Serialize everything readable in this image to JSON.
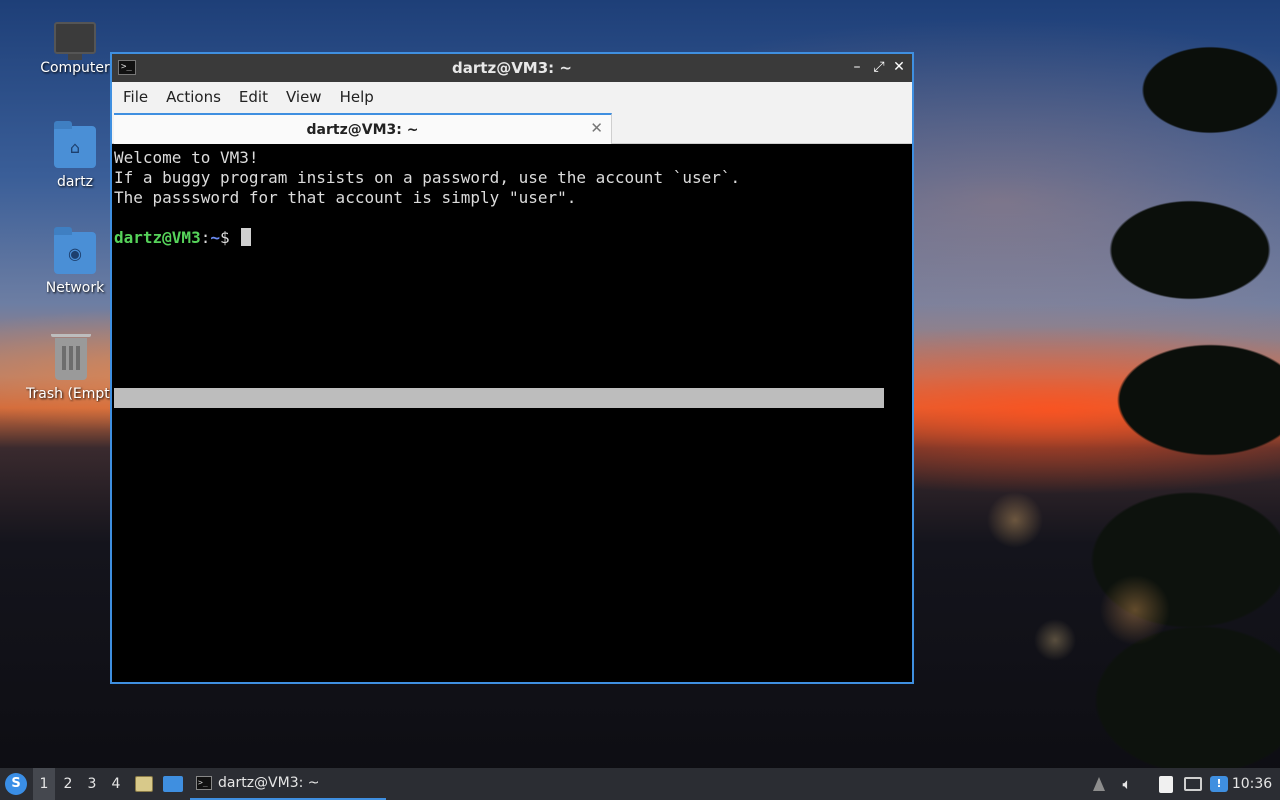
{
  "desktop": {
    "icons": [
      {
        "label": "Computer",
        "icon": "computer-icon"
      },
      {
        "label": "dartz",
        "icon": "home-folder-icon"
      },
      {
        "label": "Network",
        "icon": "network-folder-icon"
      },
      {
        "label": "Trash (Empty)",
        "icon": "trash-icon"
      }
    ]
  },
  "window": {
    "title": "dartz@VM3: ~",
    "controls": {
      "minimize": "–",
      "maximize": "⤢",
      "close": "✕"
    },
    "menu": [
      "File",
      "Actions",
      "Edit",
      "View",
      "Help"
    ],
    "tab": {
      "label": "dartz@VM3: ~",
      "close": "✕"
    },
    "terminal": {
      "lines": [
        "Welcome to VM3!",
        "If a buggy program insists on a password, use the account `user`.",
        "The passsword for that account is simply \"user\"."
      ],
      "prompt_user": "dartz@VM3",
      "prompt_sep": ":",
      "prompt_path": "~",
      "prompt_symbol": "$ "
    }
  },
  "taskbar": {
    "workspaces": [
      "1",
      "2",
      "3",
      "4"
    ],
    "active_workspace": "1",
    "task_label": "dartz@VM3: ~",
    "clock": "10:36"
  },
  "colors": {
    "accent": "#3f8fe0",
    "prompt_user": "#56d35a",
    "prompt_path": "#6b8cf5",
    "taskbar": "#2b2d33"
  }
}
